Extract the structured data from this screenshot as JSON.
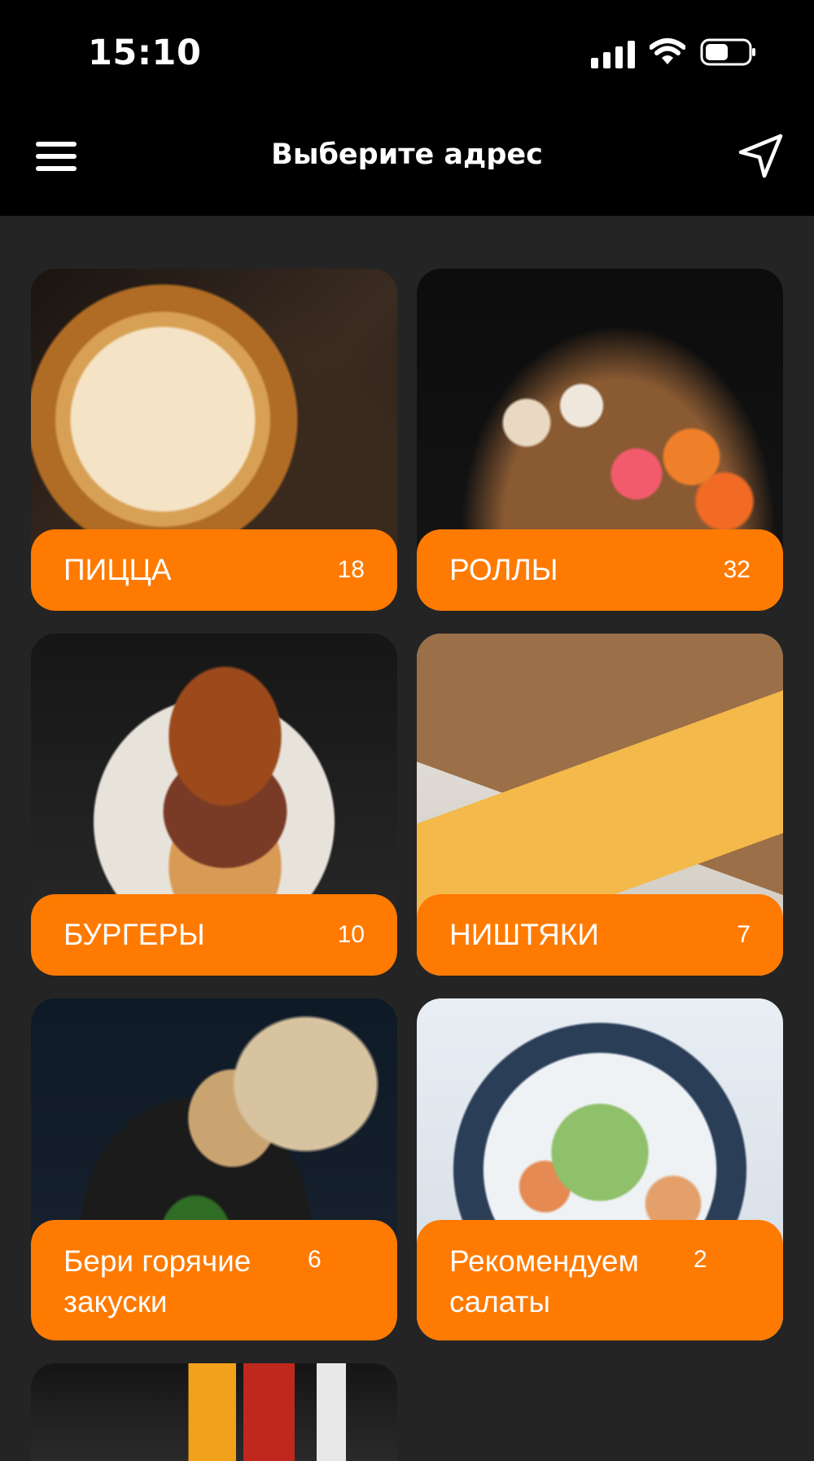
{
  "status_bar": {
    "time": "15:10",
    "icons": [
      "cellular-signal-icon",
      "wifi-icon",
      "battery-icon"
    ]
  },
  "header": {
    "title": "Выберите адрес",
    "menu_icon": "hamburger-menu-icon",
    "location_icon": "navigation-arrow-icon"
  },
  "colors": {
    "accent": "#ff7a00",
    "background": "#242424",
    "header_background": "#000000",
    "text": "#ffffff"
  },
  "categories": [
    {
      "name": "ПИЦЦА",
      "count": "18"
    },
    {
      "name": "РОЛЛЫ",
      "count": "32"
    },
    {
      "name": "БУРГЕРЫ",
      "count": "10"
    },
    {
      "name": "НИШТЯКИ",
      "count": "7"
    },
    {
      "name": "Бери горячие закуски",
      "count": "6"
    },
    {
      "name": "Рекомендуем салаты",
      "count": "2"
    }
  ]
}
